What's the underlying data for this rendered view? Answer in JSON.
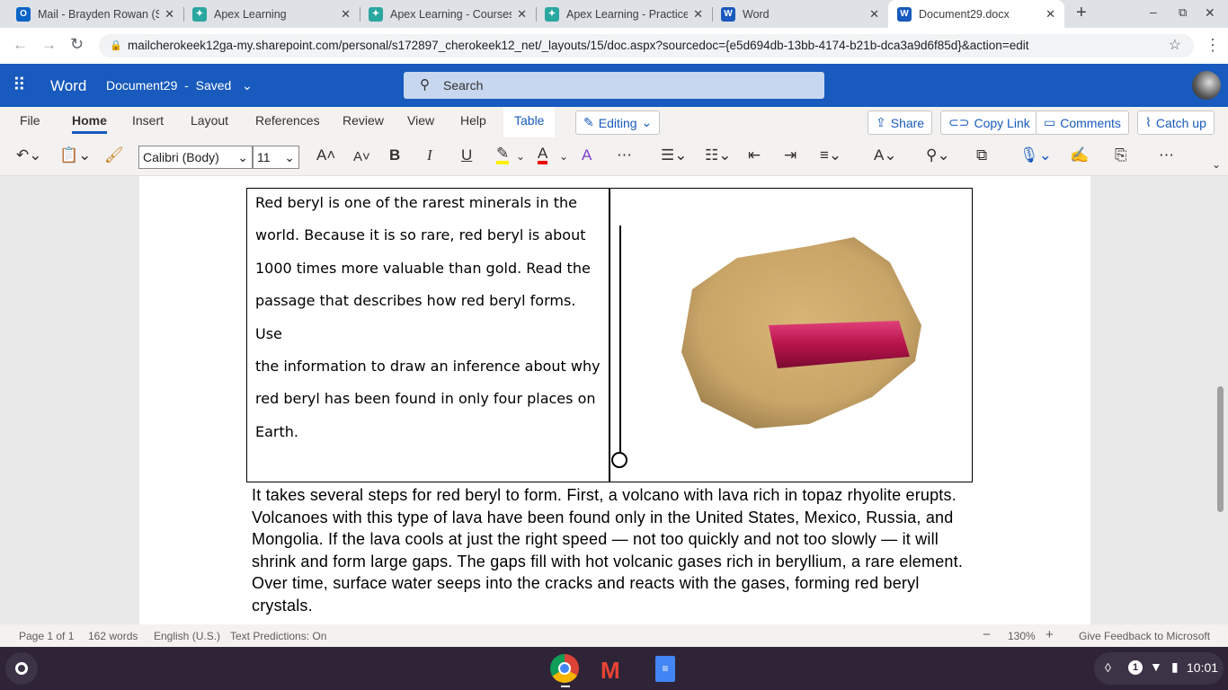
{
  "browser": {
    "tabs": [
      {
        "title": "Mail - Brayden Rowan (S",
        "icon": "outlook-icon",
        "color": "#0a64c8"
      },
      {
        "title": "Apex Learning",
        "icon": "apex-icon",
        "color": "#2aa7a0"
      },
      {
        "title": "Apex Learning - Courses",
        "icon": "apex-icon",
        "color": "#2aa7a0"
      },
      {
        "title": "Apex Learning - Practice",
        "icon": "apex-icon",
        "color": "#2aa7a0"
      },
      {
        "title": "Word",
        "icon": "word-icon",
        "color": "#185abd"
      },
      {
        "title": "Document29.docx",
        "icon": "word-icon",
        "color": "#185abd"
      }
    ],
    "url": "mailcherokeek12ga-my.sharepoint.com/personal/s172897_cherokeek12_net/_layouts/15/doc.aspx?sourcedoc={e5d694db-13bb-4174-b21b-dca3a9d6f85d}&action=edit"
  },
  "word": {
    "app": "Word",
    "doc": "Document29",
    "sep": "-",
    "saved": "Saved",
    "search": "Search",
    "menu": [
      "File",
      "Home",
      "Insert",
      "Layout",
      "References",
      "Review",
      "View",
      "Help",
      "Table"
    ],
    "editing": "Editing",
    "share": "Share",
    "copy_link": "Copy Link",
    "comments": "Comments",
    "catch_up": "Catch up",
    "font": "Calibri (Body)",
    "size": "11"
  },
  "document": {
    "cell_lines": [
      "Red beryl is one of the rarest minerals in the",
      "world. Because it is so rare, red beryl is about",
      "1000 times more valuable than gold. Read the",
      "passage that describes how red beryl forms. Use",
      "the information to draw an inference about why",
      "red beryl has been found in only four places on",
      "Earth."
    ],
    "paragraph": "It takes several steps for red beryl to form. First, a volcano with lava rich in topaz rhyolite erupts. Volcanoes with this type of lava have been found only in the United States, Mexico, Russia, and Mongolia. If the lava cools at just the right speed — not too quickly and not too slowly — it will shrink and form large gaps. The gaps fill with hot volcanic gases rich in beryllium, a rare element. Over time, surface water seeps into the cracks and reacts with the gases, forming red beryl crystals."
  },
  "status": {
    "page": "Page 1 of 1",
    "words": "162 words",
    "lang": "English (U.S.)",
    "predictions": "Text Predictions: On",
    "zoom": "130%",
    "feedback": "Give Feedback to Microsoft"
  },
  "shelf": {
    "badge": "1",
    "time": "10:01"
  }
}
